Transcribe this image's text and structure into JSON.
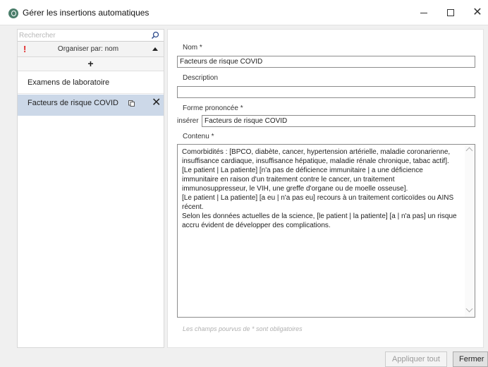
{
  "window": {
    "title": "Gérer les insertions automatiques",
    "controls": {
      "minimize_icon": "minimize-icon",
      "maximize_icon": "maximize-icon",
      "close_icon": "close-icon",
      "close_glyph": "✕"
    }
  },
  "sidebar": {
    "search": {
      "placeholder": "Rechercher",
      "value": "",
      "icon": "search-icon"
    },
    "sort": {
      "alert_glyph": "!",
      "label": "Organiser par: nom",
      "icon": "caret-up-icon"
    },
    "add_glyph": "+",
    "items": [
      {
        "label": "Examens de laboratoire",
        "selected": false
      },
      {
        "label": "Facteurs de risque COVID",
        "selected": true,
        "duplicate_icon": "duplicate-icon",
        "delete_glyph": "✕"
      }
    ]
  },
  "form": {
    "name": {
      "label": "Nom *",
      "value": "Facteurs de risque COVID"
    },
    "description": {
      "label": "Description",
      "value": ""
    },
    "spoken_form": {
      "label": "Forme prononcée *",
      "prefix": "insérer",
      "value": "Facteurs de risque COVID"
    },
    "content": {
      "label": "Contenu *",
      "value": "Comorbidités : [BPCO, diabète, cancer, hypertension artérielle, maladie coronarienne, insuffisance cardiaque, insuffisance hépatique, maladie rénale chronique, tabac actif].\n[Le patient | La patiente] [n'a pas de déficience immunitaire | a une déficience immunitaire en raison d'un traitement contre le cancer, un traitement immunosuppresseur, le VIH, une greffe d'organe ou de moelle osseuse].\n[Le patient | La patiente] [a eu | n'a pas eu] recours à un traitement corticoïdes ou AINS récent.\nSelon les données actuelles de la science, [le patient | la patiente] [a | n'a pas] un risque accru évident de développer des complications."
    },
    "required_note": "Les champs pourvus de * sont obligatoires"
  },
  "footer": {
    "apply_all": "Appliquer tout",
    "close": "Fermer"
  },
  "colors": {
    "selection": "#ccd8e8",
    "alert": "#e02020",
    "app_icon": "#4a7d6a"
  }
}
